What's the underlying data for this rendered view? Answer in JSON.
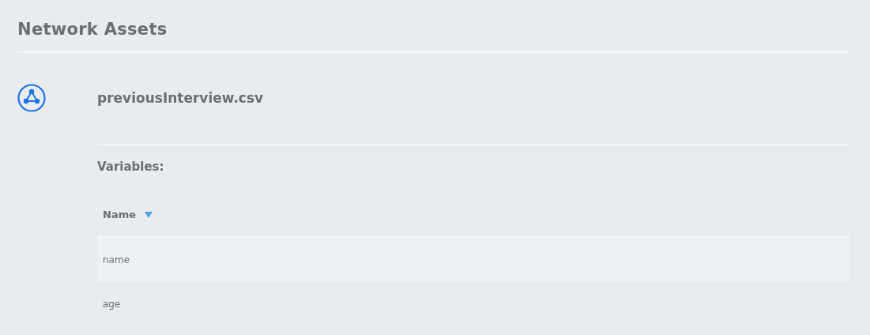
{
  "page": {
    "title": "Network Assets"
  },
  "asset": {
    "filename": "previousInterview.csv"
  },
  "variables": {
    "label": "Variables:",
    "columns": [
      "Name"
    ],
    "rows": [
      {
        "cells": [
          "name"
        ]
      },
      {
        "cells": [
          "age"
        ]
      }
    ]
  }
}
